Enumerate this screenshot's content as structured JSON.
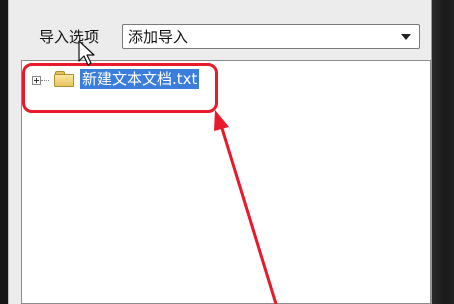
{
  "dialog": {
    "options_label": "导入选项",
    "select": {
      "value": "添加导入"
    }
  },
  "tree": {
    "items": [
      {
        "label": "新建文本文档.txt",
        "selected": true
      }
    ]
  },
  "annotation": {
    "color": "#e8192b"
  },
  "colors": {
    "selection": "#3a7ddb"
  },
  "icons": {
    "expander": "plus-expander-icon",
    "folder": "folder-icon",
    "dropdown": "chevron-down-icon",
    "cursor": "mouse-pointer-icon"
  }
}
